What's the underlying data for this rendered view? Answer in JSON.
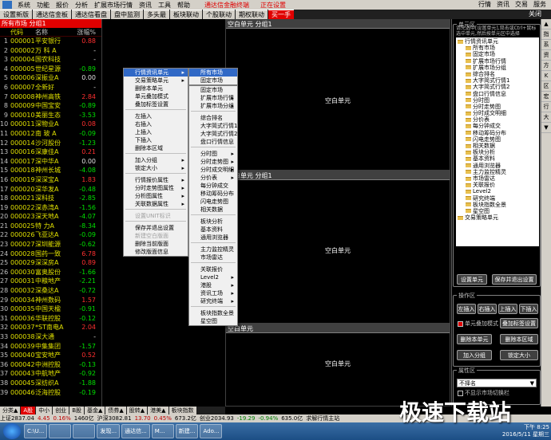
{
  "menubar": {
    "items": [
      "系统",
      "功能",
      "报价",
      "分析",
      "扩展市场行情",
      "资讯",
      "工具",
      "帮助"
    ],
    "warning": "通达信金融终端",
    "status": "正在设置",
    "right": [
      "行情",
      "资讯",
      "交易",
      "服务"
    ]
  },
  "tabs": {
    "items": [
      "设置新版",
      "通达信金板",
      "通达信看盘",
      "盘中监测",
      "多头最",
      "板块联动",
      "个股联动",
      "期权联动",
      "买一手"
    ],
    "active_index": 8,
    "close_label": "关闭"
  },
  "left": {
    "header": "所有市场 分组1",
    "columns": [
      "",
      "代码",
      "名称",
      "涨幅%"
    ],
    "rows": [
      [
        "1",
        "000001",
        "平安银行",
        "0.88",
        "up"
      ],
      [
        "2",
        "000002",
        "万 科 A",
        "-",
        "fl"
      ],
      [
        "3",
        "000004",
        "国农科技",
        "-",
        "fl"
      ],
      [
        "4",
        "000005",
        "世纪星源",
        "-0.89",
        "dn"
      ],
      [
        "5",
        "000006",
        "深振业A",
        "0.00",
        "fl"
      ],
      [
        "6",
        "000007",
        "全新好",
        "-",
        "fl"
      ],
      [
        "7",
        "000008",
        "神州高铁",
        "2.84",
        "up"
      ],
      [
        "8",
        "000009",
        "中国宝安",
        "-0.89",
        "dn"
      ],
      [
        "9",
        "000010",
        "美丽生态",
        "-3.53",
        "dn"
      ],
      [
        "10",
        "000011",
        "深物业A",
        "0.08",
        "up"
      ],
      [
        "11",
        "000012",
        "南 玻 A",
        "-0.09",
        "dn"
      ],
      [
        "12",
        "000014",
        "沙河股份",
        "-1.23",
        "dn"
      ],
      [
        "13",
        "000016",
        "深康佳A",
        "0.21",
        "up"
      ],
      [
        "14",
        "000017",
        "深中华A",
        "0.00",
        "fl"
      ],
      [
        "15",
        "000018",
        "神州长城",
        "-4.08",
        "dn"
      ],
      [
        "16",
        "000019",
        "深深宝A",
        "1.83",
        "up"
      ],
      [
        "17",
        "000020",
        "深华发A",
        "-0.48",
        "dn"
      ],
      [
        "18",
        "000021",
        "深科技",
        "-2.85",
        "dn"
      ],
      [
        "19",
        "000022",
        "深赤湾A",
        "-1.56",
        "dn"
      ],
      [
        "20",
        "000023",
        "深天地A",
        "-4.07",
        "dn"
      ],
      [
        "21",
        "000025",
        "特 力A",
        "-8.34",
        "dn"
      ],
      [
        "22",
        "000026",
        "飞亚达A",
        "-0.09",
        "dn"
      ],
      [
        "23",
        "000027",
        "深圳能源",
        "-0.62",
        "dn"
      ],
      [
        "24",
        "000028",
        "国药一致",
        "6.78",
        "up"
      ],
      [
        "25",
        "000029",
        "深深房A",
        "0.89",
        "up"
      ],
      [
        "26",
        "000030",
        "富奥股份",
        "-1.66",
        "dn"
      ],
      [
        "27",
        "000031",
        "中粮地产",
        "-2.21",
        "dn"
      ],
      [
        "28",
        "000032",
        "深桑达A",
        "-0.72",
        "dn"
      ],
      [
        "29",
        "000034",
        "神州数码",
        "1.57",
        "up"
      ],
      [
        "30",
        "000035",
        "中国天楹",
        "-0.91",
        "dn"
      ],
      [
        "31",
        "000036",
        "华联控股",
        "-0.12",
        "dn"
      ],
      [
        "32",
        "000037",
        "*ST南电A",
        "2.04",
        "up"
      ],
      [
        "33",
        "000038",
        "深大通",
        "-",
        "fl"
      ],
      [
        "34",
        "000039",
        "中集集团",
        "-1.57",
        "dn"
      ],
      [
        "35",
        "000040",
        "宝安地产",
        "0.52",
        "up"
      ],
      [
        "36",
        "000042",
        "中洲控股",
        "-0.13",
        "dn"
      ],
      [
        "37",
        "000043",
        "中航地产",
        "-0.92",
        "dn"
      ],
      [
        "38",
        "000045",
        "深纺织A",
        "-1.88",
        "dn"
      ],
      [
        "39",
        "000046",
        "泛海控股",
        "-0.19",
        "dn"
      ]
    ]
  },
  "cells": [
    {
      "title": "空白单元 分组1",
      "label": "空白单元"
    },
    {
      "title": "空白单元 分组1",
      "label": "空白单元"
    },
    {
      "title": "空白单元",
      "label": "空白单元"
    }
  ],
  "context_menu": {
    "items": [
      {
        "label": "行情资讯单元",
        "arrow": true,
        "sel": true
      },
      {
        "label": "交易策略单元",
        "arrow": true
      },
      {
        "label": "删除本单元"
      },
      {
        "label": "单元叠加模式"
      },
      {
        "label": "叠加标签设置"
      },
      {
        "sep": true
      },
      {
        "label": "左插入"
      },
      {
        "label": "右插入"
      },
      {
        "label": "上插入"
      },
      {
        "label": "下插入"
      },
      {
        "label": "删除本区域"
      },
      {
        "sep": true
      },
      {
        "label": "加入分组",
        "arrow": true
      },
      {
        "label": "锁定大小",
        "arrow": true
      },
      {
        "sep": true
      },
      {
        "label": "行情报价属性",
        "arrow": true
      },
      {
        "label": "分时走势图属性",
        "arrow": true
      },
      {
        "label": "分析图属性",
        "arrow": true
      },
      {
        "label": "关联数据属性",
        "arrow": true
      },
      {
        "sep": true
      },
      {
        "label": "设置UNIT标识",
        "dis": true
      },
      {
        "sep": true
      },
      {
        "label": "保存并退出设置"
      },
      {
        "label": "新建空白版面",
        "dis": true
      },
      {
        "label": "删除当前版面"
      },
      {
        "label": "修改版面信息"
      }
    ]
  },
  "submenu1": {
    "items": [
      {
        "label": "所有市场",
        "sel": true
      },
      {
        "label": "固定市场"
      }
    ]
  },
  "submenu2": {
    "items": [
      {
        "label": "固定市场"
      },
      {
        "label": "扩展市场行情",
        "arrow": true
      },
      {
        "label": "扩展市场分组",
        "arrow": true
      },
      {
        "sep": true
      },
      {
        "label": "综合排名"
      },
      {
        "label": "大字简式行情1"
      },
      {
        "label": "大字简式行情2"
      },
      {
        "label": "盘口行情信息"
      },
      {
        "sep": true
      },
      {
        "label": "分时图",
        "arrow": true
      },
      {
        "label": "分时走势图",
        "arrow": true
      },
      {
        "label": "分时成交明细",
        "arrow": true
      },
      {
        "label": "分价表",
        "arrow": true
      },
      {
        "label": "每分钟成交"
      },
      {
        "label": "移动筹码分布"
      },
      {
        "label": "闪电走势图"
      },
      {
        "label": "相关数据"
      },
      {
        "sep": true
      },
      {
        "label": "板块分析"
      },
      {
        "label": "基本资料"
      },
      {
        "label": "通用浏览器"
      },
      {
        "sep": true
      },
      {
        "label": "主力监控精灵"
      },
      {
        "label": "市场雷达"
      },
      {
        "sep": true
      },
      {
        "label": "关联报价"
      },
      {
        "label": "Level2",
        "arrow": true
      },
      {
        "label": "港股",
        "arrow": true
      },
      {
        "label": "资讯工场",
        "arrow": true
      },
      {
        "label": "研究终端",
        "arrow": true
      },
      {
        "sep": true
      },
      {
        "label": "板块指数全景"
      },
      {
        "label": "星空图"
      }
    ]
  },
  "right": {
    "group1_title": "单元区",
    "note": "请先选中[设置单元],双击或Ctrl+鼠标选中单元,然后按单元区中选择",
    "tree": [
      {
        "t": "行情资讯单元",
        "lvl": 0
      },
      {
        "t": "所有市场",
        "lvl": 1
      },
      {
        "t": "固定市场",
        "lvl": 1
      },
      {
        "t": "扩展市场行情",
        "lvl": 1
      },
      {
        "t": "扩展市场分组",
        "lvl": 1
      },
      {
        "t": "综合排名",
        "lvl": 1
      },
      {
        "t": "大字简式行情1",
        "lvl": 1
      },
      {
        "t": "大字简式行情2",
        "lvl": 1
      },
      {
        "t": "盘口行情信息",
        "lvl": 1
      },
      {
        "t": "分时图",
        "lvl": 1
      },
      {
        "t": "分时走势图",
        "lvl": 1
      },
      {
        "t": "分时成交明细",
        "lvl": 1
      },
      {
        "t": "分价表",
        "lvl": 1
      },
      {
        "t": "每分钟成交",
        "lvl": 1
      },
      {
        "t": "移动筹码分布",
        "lvl": 1
      },
      {
        "t": "闪电走势图",
        "lvl": 1
      },
      {
        "t": "相关数据",
        "lvl": 1
      },
      {
        "t": "板块分析",
        "lvl": 1
      },
      {
        "t": "基本资料",
        "lvl": 1
      },
      {
        "t": "通用浏览器",
        "lvl": 1
      },
      {
        "t": "主力监控精灵",
        "lvl": 1
      },
      {
        "t": "市场雷达",
        "lvl": 1
      },
      {
        "t": "关联报价",
        "lvl": 1
      },
      {
        "t": "Level2",
        "lvl": 1
      },
      {
        "t": "研究终端",
        "lvl": 1
      },
      {
        "t": "板块指数全景",
        "lvl": 1
      },
      {
        "t": "星空图",
        "lvl": 1
      },
      {
        "t": "交易策略单元",
        "lvl": 0
      }
    ],
    "btn_set_unit": "设置单元",
    "btn_save_exit": "保存并退出设置",
    "group2_title": "操作区",
    "btn_left": "左插入",
    "btn_right": "右插入",
    "btn_up": "上插入",
    "btn_down": "下插入",
    "chk_overlay": "单元叠加模式",
    "btn_overlay_tag": "叠加标签设置",
    "btn_del_unit": "删除本单元",
    "btn_del_area": "删除本区域",
    "btn_add_group": "加入分组",
    "btn_lock": "锁定大小",
    "group3_title": "属性区",
    "select_value": "不择名",
    "chk_no_market": "不显示市场切换栏"
  },
  "scroll": [
    "▲",
    "指",
    "系",
    "资",
    "方",
    "K",
    "区",
    "宏",
    "行",
    "大",
    "▼"
  ],
  "bottomtabs": [
    "分类▲",
    "A股",
    "中小",
    "创业",
    "B股",
    "基金▲",
    "债券▲",
    "股转▲",
    "港美▲",
    "板块指数"
  ],
  "status": [
    "上证2837.04",
    "4.45",
    "0.16%",
    "1460亿",
    "沪深3082.81",
    "13.70",
    "0.45%",
    "673.2亿",
    "创业2034.93",
    "-19.29",
    "-0.94%",
    "635.0亿",
    "求解行情主站"
  ],
  "taskbar": {
    "items": [
      "C:\\U...",
      "",
      "",
      "发现...",
      "通达信...",
      "M...",
      "新建...",
      "Ado..."
    ],
    "time": "下午 8:25",
    "date": "2016/5/11 星期三"
  },
  "watermark": "极速下载站"
}
